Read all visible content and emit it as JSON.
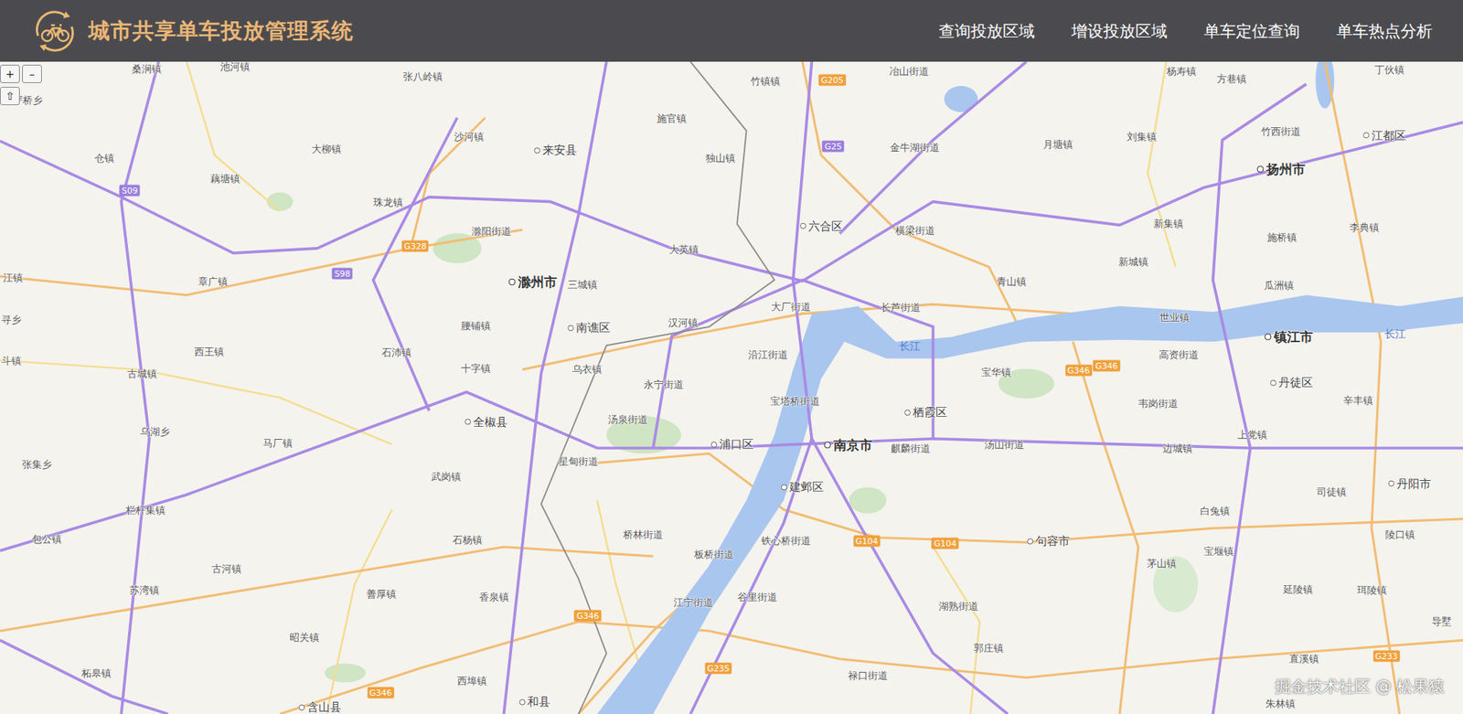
{
  "header": {
    "title": "城市共享单车投放管理系统",
    "nav": [
      "查询投放区域",
      "增设投放区域",
      "单车定位查询",
      "单车热点分析"
    ]
  },
  "map": {
    "controls": {
      "zoom_in": "+",
      "zoom_out": "–",
      "home": "⇧"
    },
    "labels": [
      {
        "text": "桑涧镇",
        "kind": "town"
      },
      {
        "text": "池河镇",
        "kind": "town"
      },
      {
        "text": "张八岭镇",
        "kind": "town"
      },
      {
        "text": "竹镇镇",
        "kind": "town"
      },
      {
        "text": "冶山街道",
        "kind": "town"
      },
      {
        "text": "杨寿镇",
        "kind": "town"
      },
      {
        "text": "方巷镇",
        "kind": "town"
      },
      {
        "text": "丁伙镇",
        "kind": "town"
      },
      {
        "text": "严桥乡",
        "kind": "town"
      },
      {
        "text": "施官镇",
        "kind": "town"
      },
      {
        "text": "大柳镇",
        "kind": "town"
      },
      {
        "text": "沙河镇",
        "kind": "town"
      },
      {
        "text": "来安县",
        "kind": "district"
      },
      {
        "text": "金牛湖街道",
        "kind": "town"
      },
      {
        "text": "月塘镇",
        "kind": "town"
      },
      {
        "text": "刘集镇",
        "kind": "town"
      },
      {
        "text": "竹西街道",
        "kind": "town"
      },
      {
        "text": "江都区",
        "kind": "district"
      },
      {
        "text": "仓镇",
        "kind": "town"
      },
      {
        "text": "独山镇",
        "kind": "town"
      },
      {
        "text": "扬州市",
        "kind": "city"
      },
      {
        "text": "藕塘镇",
        "kind": "town"
      },
      {
        "text": "珠龙镇",
        "kind": "town"
      },
      {
        "text": "六合区",
        "kind": "district"
      },
      {
        "text": "横梁街道",
        "kind": "town"
      },
      {
        "text": "新集镇",
        "kind": "town"
      },
      {
        "text": "施桥镇",
        "kind": "town"
      },
      {
        "text": "李典镇",
        "kind": "town"
      },
      {
        "text": "滁阳街道",
        "kind": "town"
      },
      {
        "text": "大英镇",
        "kind": "town"
      },
      {
        "text": "新城镇",
        "kind": "town"
      },
      {
        "text": "滁州市",
        "kind": "city"
      },
      {
        "text": "三城镇",
        "kind": "town"
      },
      {
        "text": "章广镇",
        "kind": "town"
      },
      {
        "text": "青山镇",
        "kind": "town"
      },
      {
        "text": "瓜洲镇",
        "kind": "town"
      },
      {
        "text": "大厂街道",
        "kind": "town"
      },
      {
        "text": "长芦街道",
        "kind": "town"
      },
      {
        "text": "世业镇",
        "kind": "town"
      },
      {
        "text": "腰铺镇",
        "kind": "town"
      },
      {
        "text": "南谯区",
        "kind": "district"
      },
      {
        "text": "汉河镇",
        "kind": "town"
      },
      {
        "text": "西王镇",
        "kind": "town"
      },
      {
        "text": "沿江街道",
        "kind": "town"
      },
      {
        "text": "石沛镇",
        "kind": "town"
      },
      {
        "text": "长江",
        "kind": "river"
      },
      {
        "text": "镇江市",
        "kind": "city"
      },
      {
        "text": "高资街道",
        "kind": "town"
      },
      {
        "text": "长江",
        "kind": "river"
      },
      {
        "text": "十字镇",
        "kind": "town"
      },
      {
        "text": "乌衣镇",
        "kind": "town"
      },
      {
        "text": "宝华镇",
        "kind": "town"
      },
      {
        "text": "丹徒区",
        "kind": "district"
      },
      {
        "text": "古城镇",
        "kind": "town"
      },
      {
        "text": "永宁街道",
        "kind": "town"
      },
      {
        "text": "宝塔桥街道",
        "kind": "town"
      },
      {
        "text": "栖霞区",
        "kind": "district"
      },
      {
        "text": "韦岗街道",
        "kind": "town"
      },
      {
        "text": "辛丰镇",
        "kind": "town"
      },
      {
        "text": "汤泉街道",
        "kind": "town"
      },
      {
        "text": "全椒县",
        "kind": "district"
      },
      {
        "text": "乌湖乡",
        "kind": "town"
      },
      {
        "text": "浦口区",
        "kind": "district"
      },
      {
        "text": "南京市",
        "kind": "city"
      },
      {
        "text": "麒麟街道",
        "kind": "town"
      },
      {
        "text": "汤山街道",
        "kind": "town"
      },
      {
        "text": "边城镇",
        "kind": "town"
      },
      {
        "text": "上党镇",
        "kind": "town"
      },
      {
        "text": "马厂镇",
        "kind": "town"
      },
      {
        "text": "星甸街道",
        "kind": "town"
      },
      {
        "text": "张集乡",
        "kind": "town"
      },
      {
        "text": "建邺区",
        "kind": "district"
      },
      {
        "text": "武岗镇",
        "kind": "town"
      },
      {
        "text": "司徒镇",
        "kind": "town"
      },
      {
        "text": "丹阳市",
        "kind": "district"
      },
      {
        "text": "栏杆集镇",
        "kind": "town"
      },
      {
        "text": "包公镇",
        "kind": "town"
      },
      {
        "text": "桥林街道",
        "kind": "town"
      },
      {
        "text": "白兔镇",
        "kind": "town"
      },
      {
        "text": "石杨镇",
        "kind": "town"
      },
      {
        "text": "铁心桥街道",
        "kind": "town"
      },
      {
        "text": "句容市",
        "kind": "district"
      },
      {
        "text": "陵口镇",
        "kind": "town"
      },
      {
        "text": "板桥街道",
        "kind": "town"
      },
      {
        "text": "古河镇",
        "kind": "town"
      },
      {
        "text": "宝堰镇",
        "kind": "town"
      },
      {
        "text": "茅山镇",
        "kind": "town"
      },
      {
        "text": "苏湾镇",
        "kind": "town"
      },
      {
        "text": "善厚镇",
        "kind": "town"
      },
      {
        "text": "香泉镇",
        "kind": "town"
      },
      {
        "text": "谷里街道",
        "kind": "town"
      },
      {
        "text": "延陵镇",
        "kind": "town"
      },
      {
        "text": "珥陵镇",
        "kind": "town"
      },
      {
        "text": "江宁街道",
        "kind": "town"
      },
      {
        "text": "湖熟街道",
        "kind": "town"
      },
      {
        "text": "导墅",
        "kind": "town"
      },
      {
        "text": "昭关镇",
        "kind": "town"
      },
      {
        "text": "郭庄镇",
        "kind": "town"
      },
      {
        "text": "直溪镇",
        "kind": "town"
      },
      {
        "text": "柘皋镇",
        "kind": "town"
      },
      {
        "text": "西埠镇",
        "kind": "town"
      },
      {
        "text": "禄口街道",
        "kind": "town"
      },
      {
        "text": "含山县",
        "kind": "district"
      },
      {
        "text": "和县",
        "kind": "district"
      },
      {
        "text": "朱林镇",
        "kind": "town"
      },
      {
        "text": "江镇",
        "kind": "town"
      },
      {
        "text": "寻乡",
        "kind": "town"
      },
      {
        "text": "斗镇",
        "kind": "town"
      },
      {
        "text": "G205",
        "kind": "road"
      },
      {
        "text": "G25",
        "kind": "expressway"
      },
      {
        "text": "S09",
        "kind": "expressway"
      },
      {
        "text": "G328",
        "kind": "road"
      },
      {
        "text": "S98",
        "kind": "expressway"
      },
      {
        "text": "G346",
        "kind": "road"
      },
      {
        "text": "G346",
        "kind": "road"
      },
      {
        "text": "G104",
        "kind": "road"
      },
      {
        "text": "G104",
        "kind": "road"
      },
      {
        "text": "G346",
        "kind": "road"
      },
      {
        "text": "G235",
        "kind": "road"
      },
      {
        "text": "G346",
        "kind": "road"
      },
      {
        "text": "G233",
        "kind": "road"
      }
    ]
  },
  "watermark": "掘金技术社区 @ 松果猿"
}
